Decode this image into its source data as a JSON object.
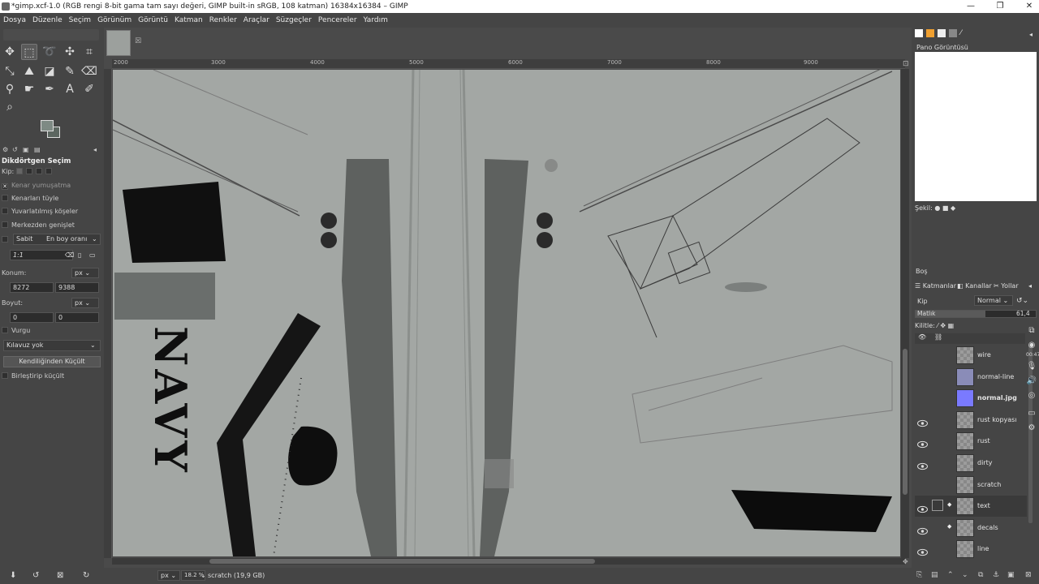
{
  "window": {
    "title": "*gimp.xcf-1.0 (RGB rengi 8-bit gama tam sayı değeri, GIMP built-in sRGB, 108 katman) 16384x16384 – GIMP",
    "controls": {
      "minimize": "—",
      "restore": "❐",
      "close": "✕"
    }
  },
  "menu": [
    "Dosya",
    "Düzenle",
    "Seçim",
    "Görünüm",
    "Görüntü",
    "Katman",
    "Renkler",
    "Araçlar",
    "Süzgeçler",
    "Pencereler",
    "Yardım"
  ],
  "tool_options": {
    "title": "Dikdörtgen Seçim",
    "mode_label": "Kip:",
    "antialias": "Kenar yumuşatma",
    "feather": "Kenarları tüyle",
    "rounded": "Yuvarlatılmış köşeler",
    "expand_center": "Merkezden genişlet",
    "fixed_label": "Sabit",
    "fixed_value": "En boy oranı",
    "ratio": "1:1",
    "position_label": "Konum:",
    "position_unit": "px",
    "pos_x": "8272",
    "pos_y": "9388",
    "size_label": "Boyut:",
    "size_unit": "px",
    "size_w": "0",
    "size_h": "0",
    "highlight": "Vurgu",
    "guides": "Kılavuz yok",
    "autoshrink_button": "Kendiliğinden Küçült",
    "merged_shrink": "Birleştirip küçült"
  },
  "canvas": {
    "ruler_ticks": [
      "2000",
      "3000",
      "4000",
      "5000",
      "6000",
      "7000",
      "8000",
      "9000"
    ],
    "navy_text": "NAVY"
  },
  "status": {
    "unit": "px",
    "zoom": "18.2 %",
    "info": "scratch (19,9 GB)"
  },
  "right_dock": {
    "navigation_title": "Pano Görüntüsü",
    "shape_label": "Şekil:",
    "bos_label": "Boş",
    "tabs": {
      "layers": "Katmanlar",
      "channels": "Kanallar",
      "paths": "Yollar"
    },
    "mode_label": "Kip",
    "mode_value": "Normal",
    "opacity_label": "Matlık",
    "opacity_value": "61,4",
    "lock_label": "Kilitle:"
  },
  "layers": [
    {
      "name": "wire",
      "visible": false,
      "bold": false
    },
    {
      "name": "normal-line",
      "visible": false,
      "bold": false
    },
    {
      "name": "normal.jpg",
      "visible": false,
      "bold": true
    },
    {
      "name": "rust kopyası",
      "visible": true,
      "bold": false
    },
    {
      "name": "rust",
      "visible": true,
      "bold": false
    },
    {
      "name": "dirty",
      "visible": true,
      "bold": false
    },
    {
      "name": "scratch",
      "visible": false,
      "bold": false
    },
    {
      "name": "text",
      "visible": true,
      "bold": false
    },
    {
      "name": "decals",
      "visible": true,
      "bold": false
    },
    {
      "name": "line",
      "visible": true,
      "bold": false
    }
  ],
  "colors": {
    "fg": "#7e8a84",
    "bg": "#5c6660",
    "canvas": "#a3a7a4",
    "accent_normal": "#7a7aff"
  }
}
